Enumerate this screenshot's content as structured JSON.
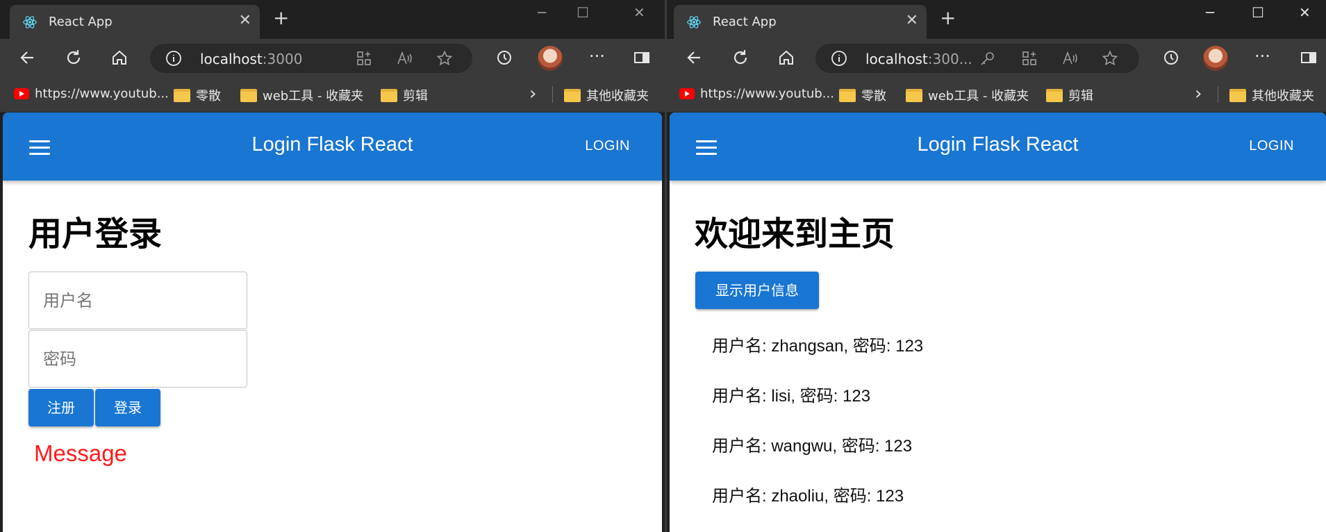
{
  "left": {
    "tab_title": "React App",
    "address": {
      "host": "localhost",
      "port": ":3000"
    },
    "bookmarks": [
      "https://www.youtub...",
      "零散",
      "web工具 - 收藏夹",
      "剪辑",
      "其他收藏夹"
    ],
    "app": {
      "title": "Login Flask React",
      "login_label": "LOGIN",
      "heading": "用户登录",
      "username_placeholder": "用户名",
      "password_placeholder": "密码",
      "register_label": "注册",
      "login_button_label": "登录",
      "message": "Message"
    }
  },
  "right": {
    "tab_title": "React App",
    "address": {
      "host": "localhost",
      "port": ":300..."
    },
    "bookmarks": [
      "https://www.youtub...",
      "零散",
      "web工具 - 收藏夹",
      "剪辑",
      "其他收藏夹"
    ],
    "app": {
      "title": "Login Flask React",
      "login_label": "LOGIN",
      "heading": "欢迎来到主页",
      "show_users_label": "显示用户信息",
      "users": [
        "用户名: zhangsan, 密码: 123",
        "用户名: lisi, 密码: 123",
        "用户名: wangwu, 密码: 123",
        "用户名: zhaoliu, 密码: 123"
      ]
    }
  },
  "colors": {
    "primary": "#1976d2",
    "message": "#ff1a1a",
    "chrome": "#3a3a3a"
  }
}
